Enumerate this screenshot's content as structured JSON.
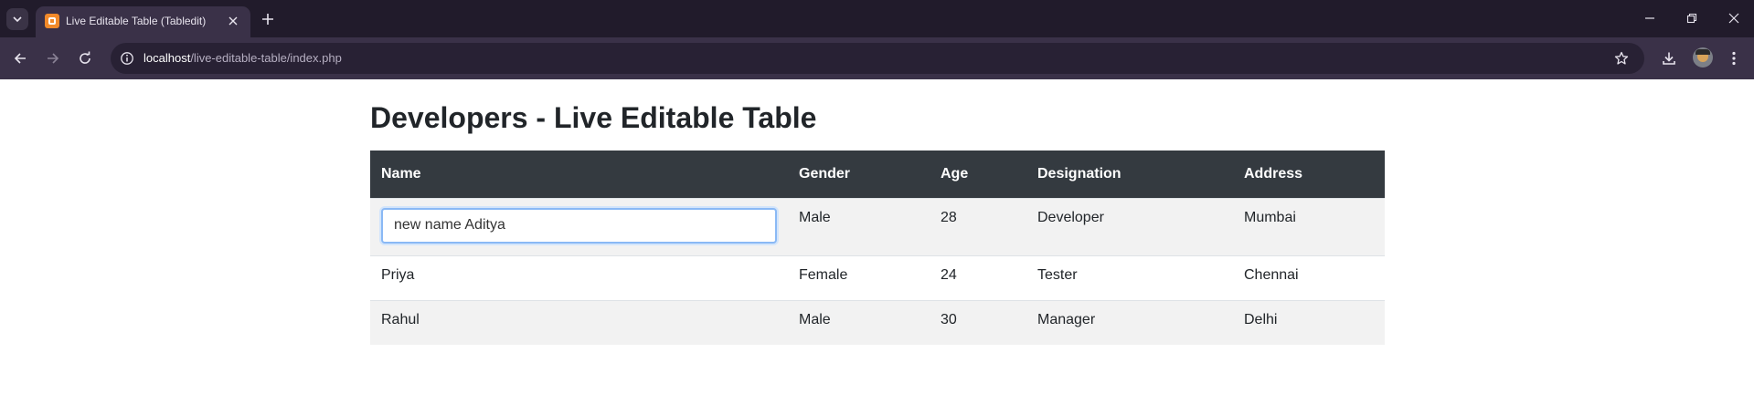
{
  "browser": {
    "tab_title": "Live Editable Table (Tabledit)",
    "url_host": "localhost",
    "url_path": "/live-editable-table/index.php"
  },
  "page": {
    "heading": "Developers - Live Editable Table"
  },
  "table": {
    "headers": [
      "Name",
      "Gender",
      "Age",
      "Designation",
      "Address"
    ],
    "rows": [
      {
        "name": "new name Aditya",
        "gender": "Male",
        "age": "28",
        "designation": "Developer",
        "address": "Mumbai"
      },
      {
        "name": "Priya",
        "gender": "Female",
        "age": "24",
        "designation": "Tester",
        "address": "Chennai"
      },
      {
        "name": "Rahul",
        "gender": "Male",
        "age": "30",
        "designation": "Manager",
        "address": "Delhi"
      }
    ]
  },
  "colors": {
    "header_bg": "#343a40",
    "focus_border": "#8ab9f5"
  }
}
